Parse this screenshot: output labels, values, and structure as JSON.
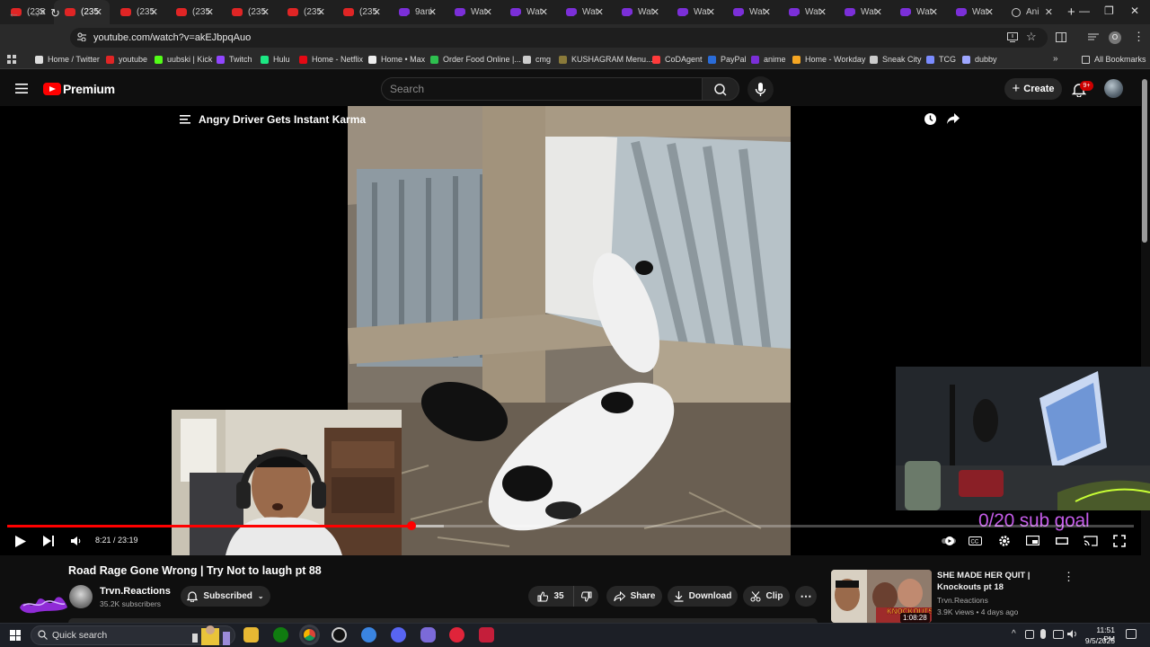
{
  "browser": {
    "tabs": [
      {
        "label": "(235",
        "kind": "yt"
      },
      {
        "label": "(235",
        "kind": "yt",
        "active": true
      },
      {
        "label": "(235",
        "kind": "yt"
      },
      {
        "label": "(235",
        "kind": "yt"
      },
      {
        "label": "(235",
        "kind": "yt"
      },
      {
        "label": "(235",
        "kind": "yt"
      },
      {
        "label": "(235",
        "kind": "yt"
      },
      {
        "label": "9ani",
        "kind": "tw"
      },
      {
        "label": "Wat",
        "kind": "tw"
      },
      {
        "label": "Wat",
        "kind": "tw"
      },
      {
        "label": "Wat",
        "kind": "tw"
      },
      {
        "label": "Wat",
        "kind": "tw"
      },
      {
        "label": "Wat",
        "kind": "tw"
      },
      {
        "label": "Wat",
        "kind": "tw"
      },
      {
        "label": "Wat",
        "kind": "tw"
      },
      {
        "label": "Wat",
        "kind": "tw"
      },
      {
        "label": "Wat",
        "kind": "tw"
      },
      {
        "label": "Wat",
        "kind": "tw"
      },
      {
        "label": "Ani",
        "kind": "an"
      }
    ],
    "url": "youtube.com/watch?v=akEJbpqAuo",
    "bookmarks": [
      {
        "label": "Home / Twitter",
        "color": "#dddddd"
      },
      {
        "label": "youtube",
        "color": "#e02525"
      },
      {
        "label": "uubski | Kick",
        "color": "#53fc18"
      },
      {
        "label": "Twitch",
        "color": "#9146ff"
      },
      {
        "label": "Hulu",
        "color": "#1ce783"
      },
      {
        "label": "Home - Netflix",
        "color": "#e50914"
      },
      {
        "label": "Home • Max",
        "color": "#eeeeee"
      },
      {
        "label": "Order Food Online |...",
        "color": "#2ec04f"
      },
      {
        "label": "cmg",
        "color": "#cccccc"
      },
      {
        "label": "KUSHAGRAM Menu...",
        "color": "#8a7a3a"
      },
      {
        "label": "CoDAgent",
        "color": "#ff3b3b"
      },
      {
        "label": "PayPal",
        "color": "#2a6cd8"
      },
      {
        "label": "anime",
        "color": "#7b2fd8"
      },
      {
        "label": "Home - Workday",
        "color": "#f5a623"
      },
      {
        "label": "Sneak City",
        "color": "#cccccc"
      },
      {
        "label": "TCG",
        "color": "#7b8cff"
      },
      {
        "label": "dubby",
        "color": "#9ea7ff"
      }
    ],
    "all_bookmarks": "All Bookmarks",
    "profile_initial": "O"
  },
  "youtube": {
    "brand": "Premium",
    "search_placeholder": "Search",
    "create_label": "Create",
    "notif_count": "9+",
    "player": {
      "title": "Angry Driver Gets Instant Karma",
      "time": "8:21 / 23:19",
      "progress": 0.359,
      "overlay_text": "0/20 sub goal"
    },
    "video": {
      "title": "Road Rage Gone Wrong | Try Not to laugh pt 88",
      "channel": "Trvn.Reactions",
      "subscribers": "35.2K subscribers",
      "subscribed_label": "Subscribed",
      "likes": "35",
      "share_label": "Share",
      "download_label": "Download",
      "clip_label": "Clip"
    },
    "recommendation": {
      "title": "SHE MADE HER QUIT | Knockouts pt 18",
      "channel": "Trvn.Reactions",
      "meta": "3.9K views • 4 days ago",
      "duration": "1:08:28",
      "thumb_text": "KNOCKOUTS"
    }
  },
  "taskbar": {
    "search_label": "Quick search",
    "time": "11:51 PM",
    "date": "9/5/2025"
  }
}
